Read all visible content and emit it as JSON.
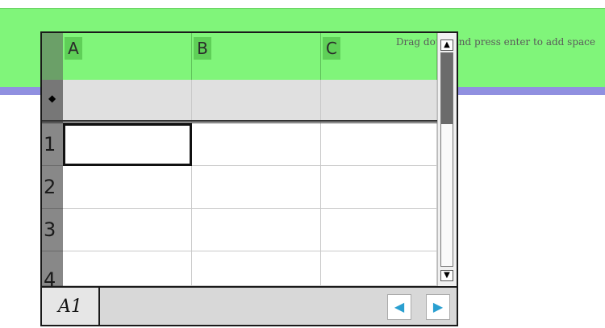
{
  "band": {
    "hint": "Drag down and press enter to add space"
  },
  "sheet": {
    "columns": [
      "A",
      "B",
      "C"
    ],
    "formula_marker": "◆",
    "rows": [
      "1",
      "2",
      "3",
      "4"
    ],
    "selected_cell": "A1",
    "cell_ref": "A1"
  },
  "icons": {
    "scroll_up": "up-arrow-icon",
    "scroll_down": "down-arrow-icon",
    "prev": "left-triangle-icon",
    "next": "right-triangle-icon"
  },
  "colors": {
    "band": "#80f57a",
    "band_line": "#9090e0",
    "nav_arrow": "#2a9fd0"
  }
}
